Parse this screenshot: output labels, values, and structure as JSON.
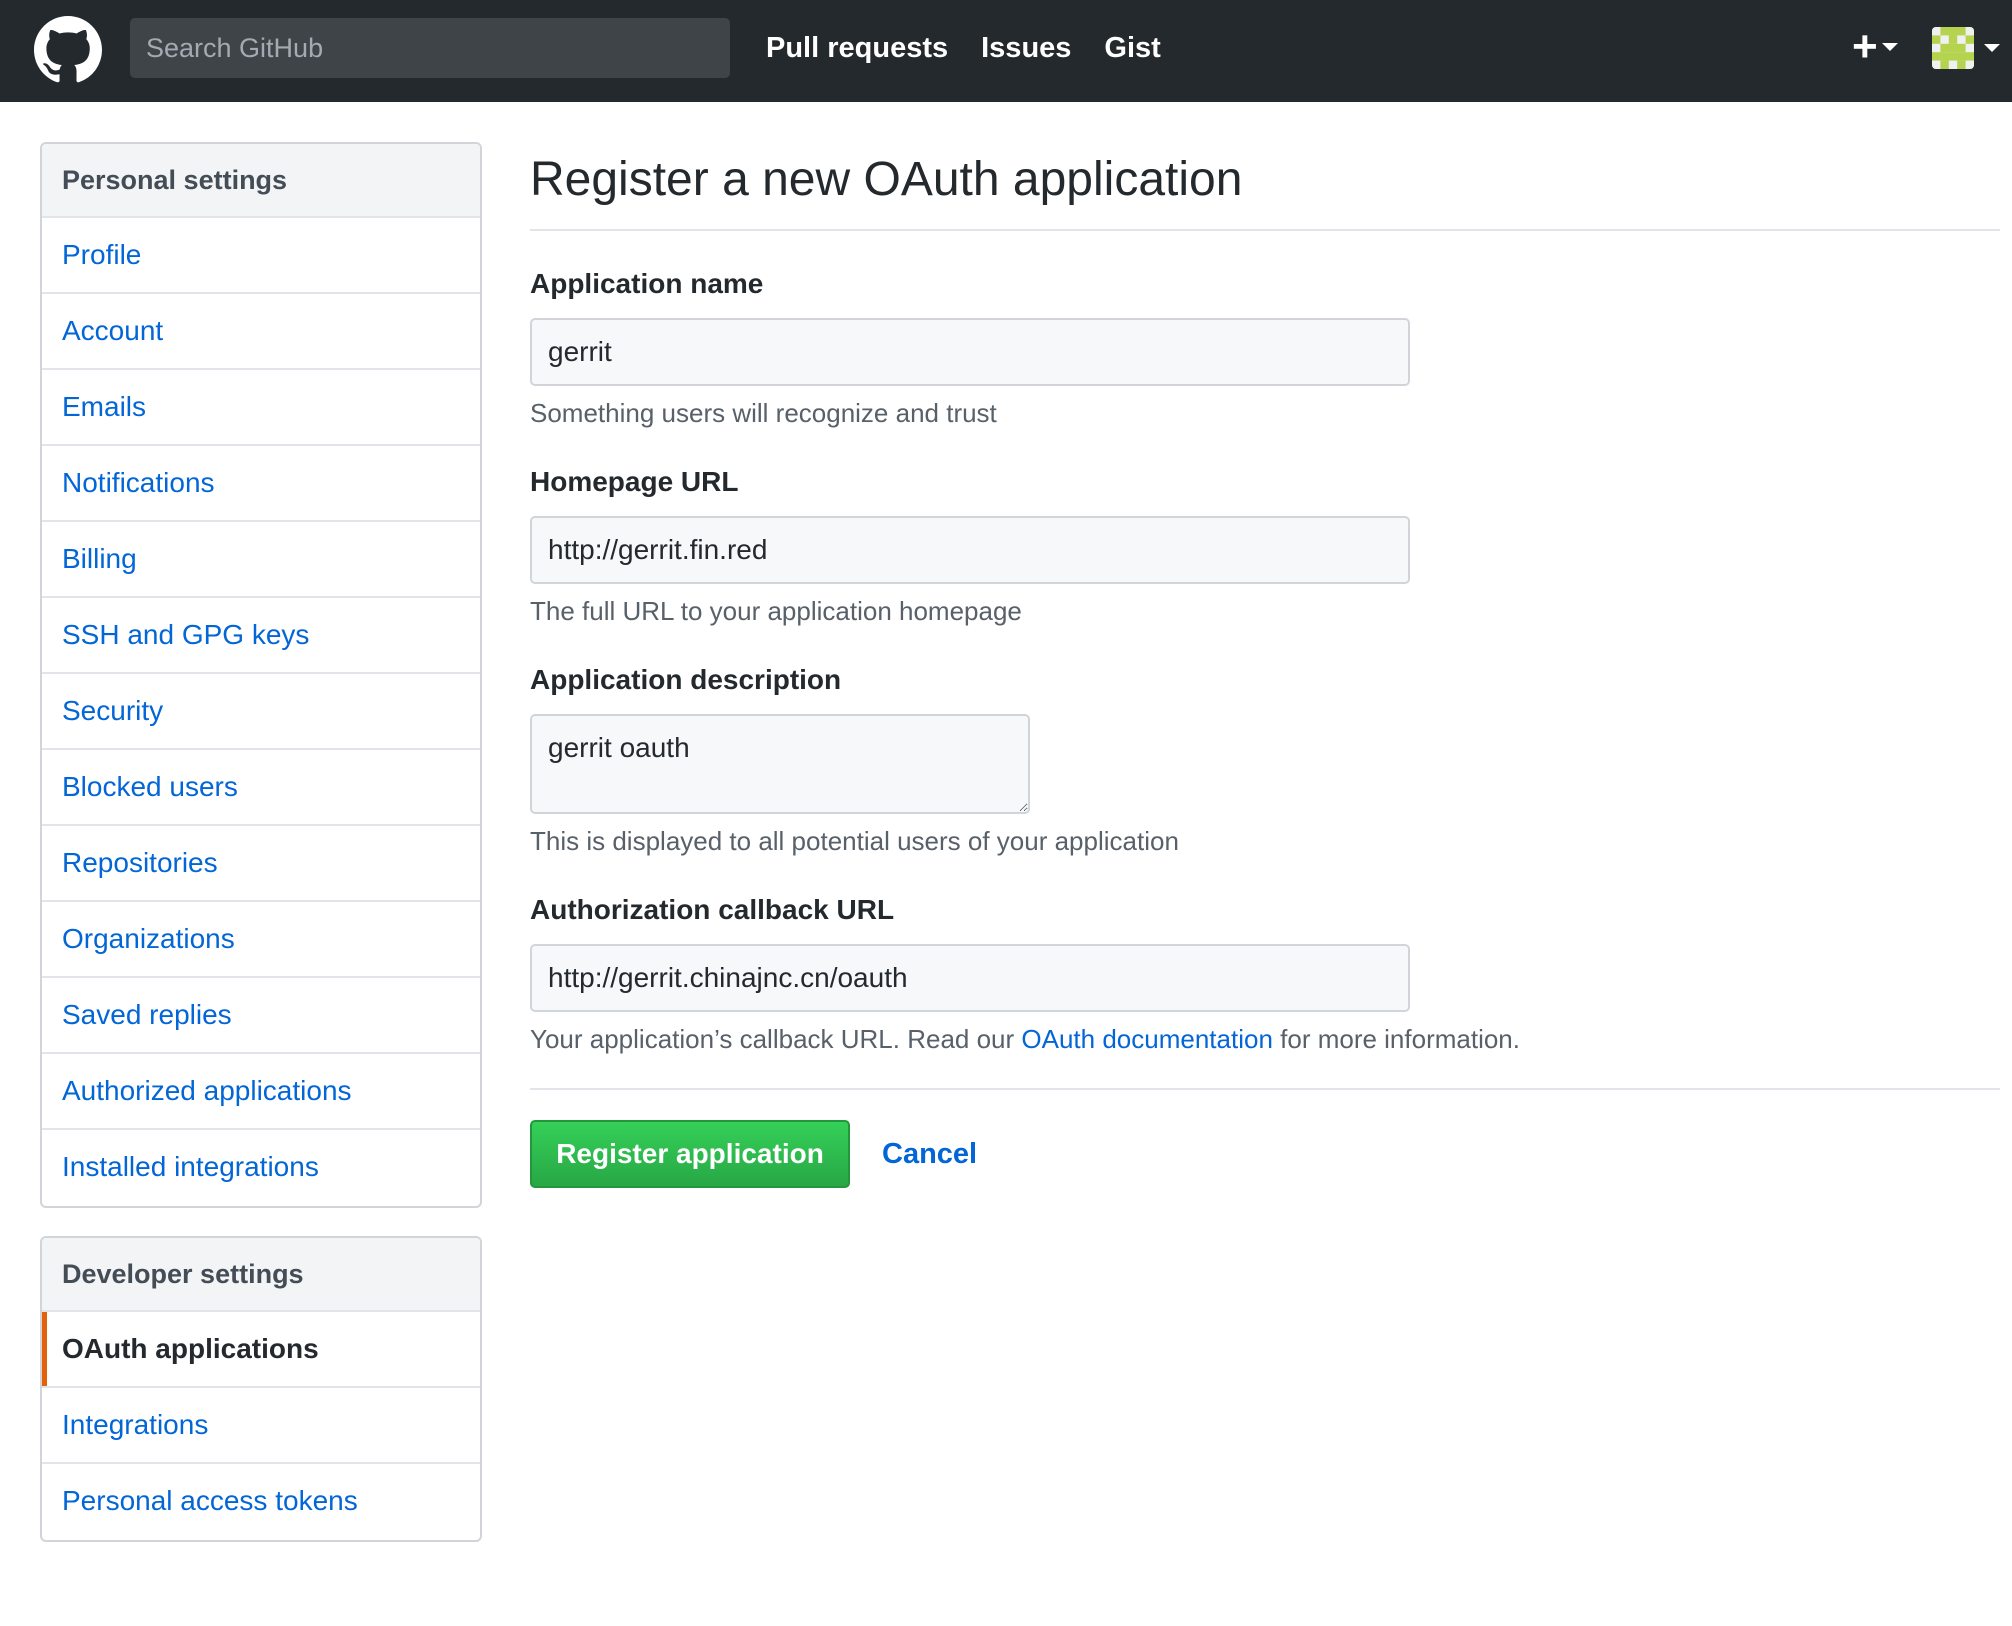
{
  "header": {
    "search_placeholder": "Search GitHub",
    "nav": [
      "Pull requests",
      "Issues",
      "Gist"
    ],
    "plus_label": "+",
    "logo_icon": "github-octocat-icon"
  },
  "sidebar": {
    "personal": {
      "title": "Personal settings",
      "items": [
        "Profile",
        "Account",
        "Emails",
        "Notifications",
        "Billing",
        "SSH and GPG keys",
        "Security",
        "Blocked users",
        "Repositories",
        "Organizations",
        "Saved replies",
        "Authorized applications",
        "Installed integrations"
      ]
    },
    "developer": {
      "title": "Developer settings",
      "items": [
        "OAuth applications",
        "Integrations",
        "Personal access tokens"
      ],
      "selected": "OAuth applications"
    }
  },
  "main": {
    "title": "Register a new OAuth application",
    "app_name": {
      "label": "Application name",
      "value": "gerrit",
      "note": "Something users will recognize and trust"
    },
    "homepage": {
      "label": "Homepage URL",
      "value": "http://gerrit.fin.red",
      "note": "The full URL to your application homepage"
    },
    "description": {
      "label": "Application description",
      "value": "gerrit oauth",
      "note": "This is displayed to all potential users of your application"
    },
    "callback": {
      "label": "Authorization callback URL",
      "value": "http://gerrit.chinajnc.cn/oauth",
      "note_before": "Your application’s callback URL. Read our ",
      "note_link": "OAuth documentation",
      "note_after": " for more information."
    },
    "register_label": "Register application",
    "cancel_label": "Cancel"
  },
  "colors": {
    "header_bg": "#24292e",
    "link": "#0366d6",
    "primary_button": "#28a745",
    "selected_accent": "#e36209"
  }
}
